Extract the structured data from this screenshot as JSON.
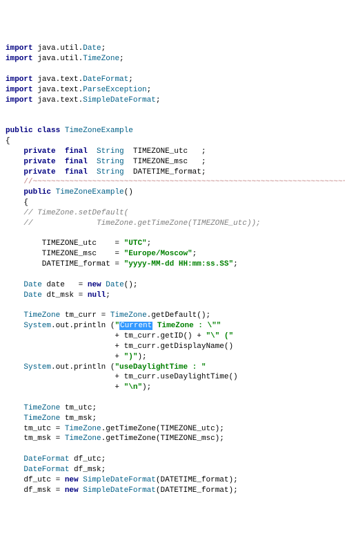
{
  "code": {
    "kw_import": "import",
    "kw_public": "public",
    "kw_class": "class",
    "kw_private": "private",
    "kw_final": "final",
    "kw_new": "new",
    "kw_null": "null",
    "type_String": "String",
    "type_Date": "Date",
    "type_TimeZone": "TimeZone",
    "type_DateFormat": "DateFormat",
    "type_ParseException": "ParseException",
    "type_SimpleDateFormat": "SimpleDateFormat",
    "type_System": "System",
    "path_java_util": "java.util.",
    "path_java_text": "java.text.",
    "class_name": "TimeZoneExample",
    "field_TIMEZONE_utc": "TIMEZONE_utc",
    "field_TIMEZONE_msc": "TIMEZONE_msc",
    "field_DATETIME_format": "DATETIME_format",
    "wave_line": "//~~~~~~~~~~~~~~~~~~~~~~~~~~~~~~~~~~~~~~~~~~~~~~~~~~~~~~~~~~~~~~~~~~~~~~",
    "ctor_decl": "TimeZoneExample",
    "cmt_setDefault1": "// TimeZone.setDefault(",
    "cmt_setDefault2": "//              TimeZone.getTimeZone(TIMEZONE_utc));",
    "str_UTC": "\"UTC\"",
    "str_Moscow": "\"Europe/Moscow\"",
    "str_fmt": "\"yyyy-MM-dd HH:mm:ss.SS\"",
    "assign_TIMEZONE_utc": "        TIMEZONE_utc    = ",
    "assign_TIMEZONE_msc": "        TIMEZONE_msc    = ",
    "assign_DATETIME_format": "        DATETIME_format = ",
    "var_date": "date",
    "var_dt_msk": "dt_msk",
    "var_tm_curr": "tm_curr",
    "call_getDefault": ".getDefault();",
    "method_println": ".out.println (",
    "str_Current_pre": "\"",
    "str_Current_sel": "Current",
    "str_Current_post": " TimeZone : \\\"\"",
    "concat1": "                        + tm_curr.getID() + ",
    "str_slash_quote_paren": "\"\\\" (\"",
    "concat2": "                        + tm_curr.getDisplayName()",
    "concat3": "                        + ",
    "str_close_paren": "\")\"",
    "concat_close": ");",
    "str_useDaylight": "\"useDaylightTime : \"",
    "concat4": "                        + tm_curr.useDaylightTime()",
    "str_newline": "\"\\n\"",
    "var_tm_utc": "tm_utc",
    "var_tm_msk": "tm_msk",
    "assign_tm_utc": "    tm_utc = ",
    "assign_tm_msk": "    tm_msk = ",
    "call_getTimeZone_utc": ".getTimeZone(TIMEZONE_utc);",
    "call_getTimeZone_msc": ".getTimeZone(TIMEZONE_msc);",
    "var_df_utc": "df_utc",
    "var_df_msk": "df_msk",
    "assign_df_utc": "    df_utc = ",
    "assign_df_msk": "    df_msk = ",
    "ctor_SDF": "(DATETIME_format);",
    "semi": ";",
    "lbrace": "{",
    "rbrace": "}",
    "space1": " ",
    "decl_sep": "  ",
    "eq_new": "   = ",
    "eq_null": " = ",
    "paren_empty": "()",
    "newDate": "();"
  }
}
